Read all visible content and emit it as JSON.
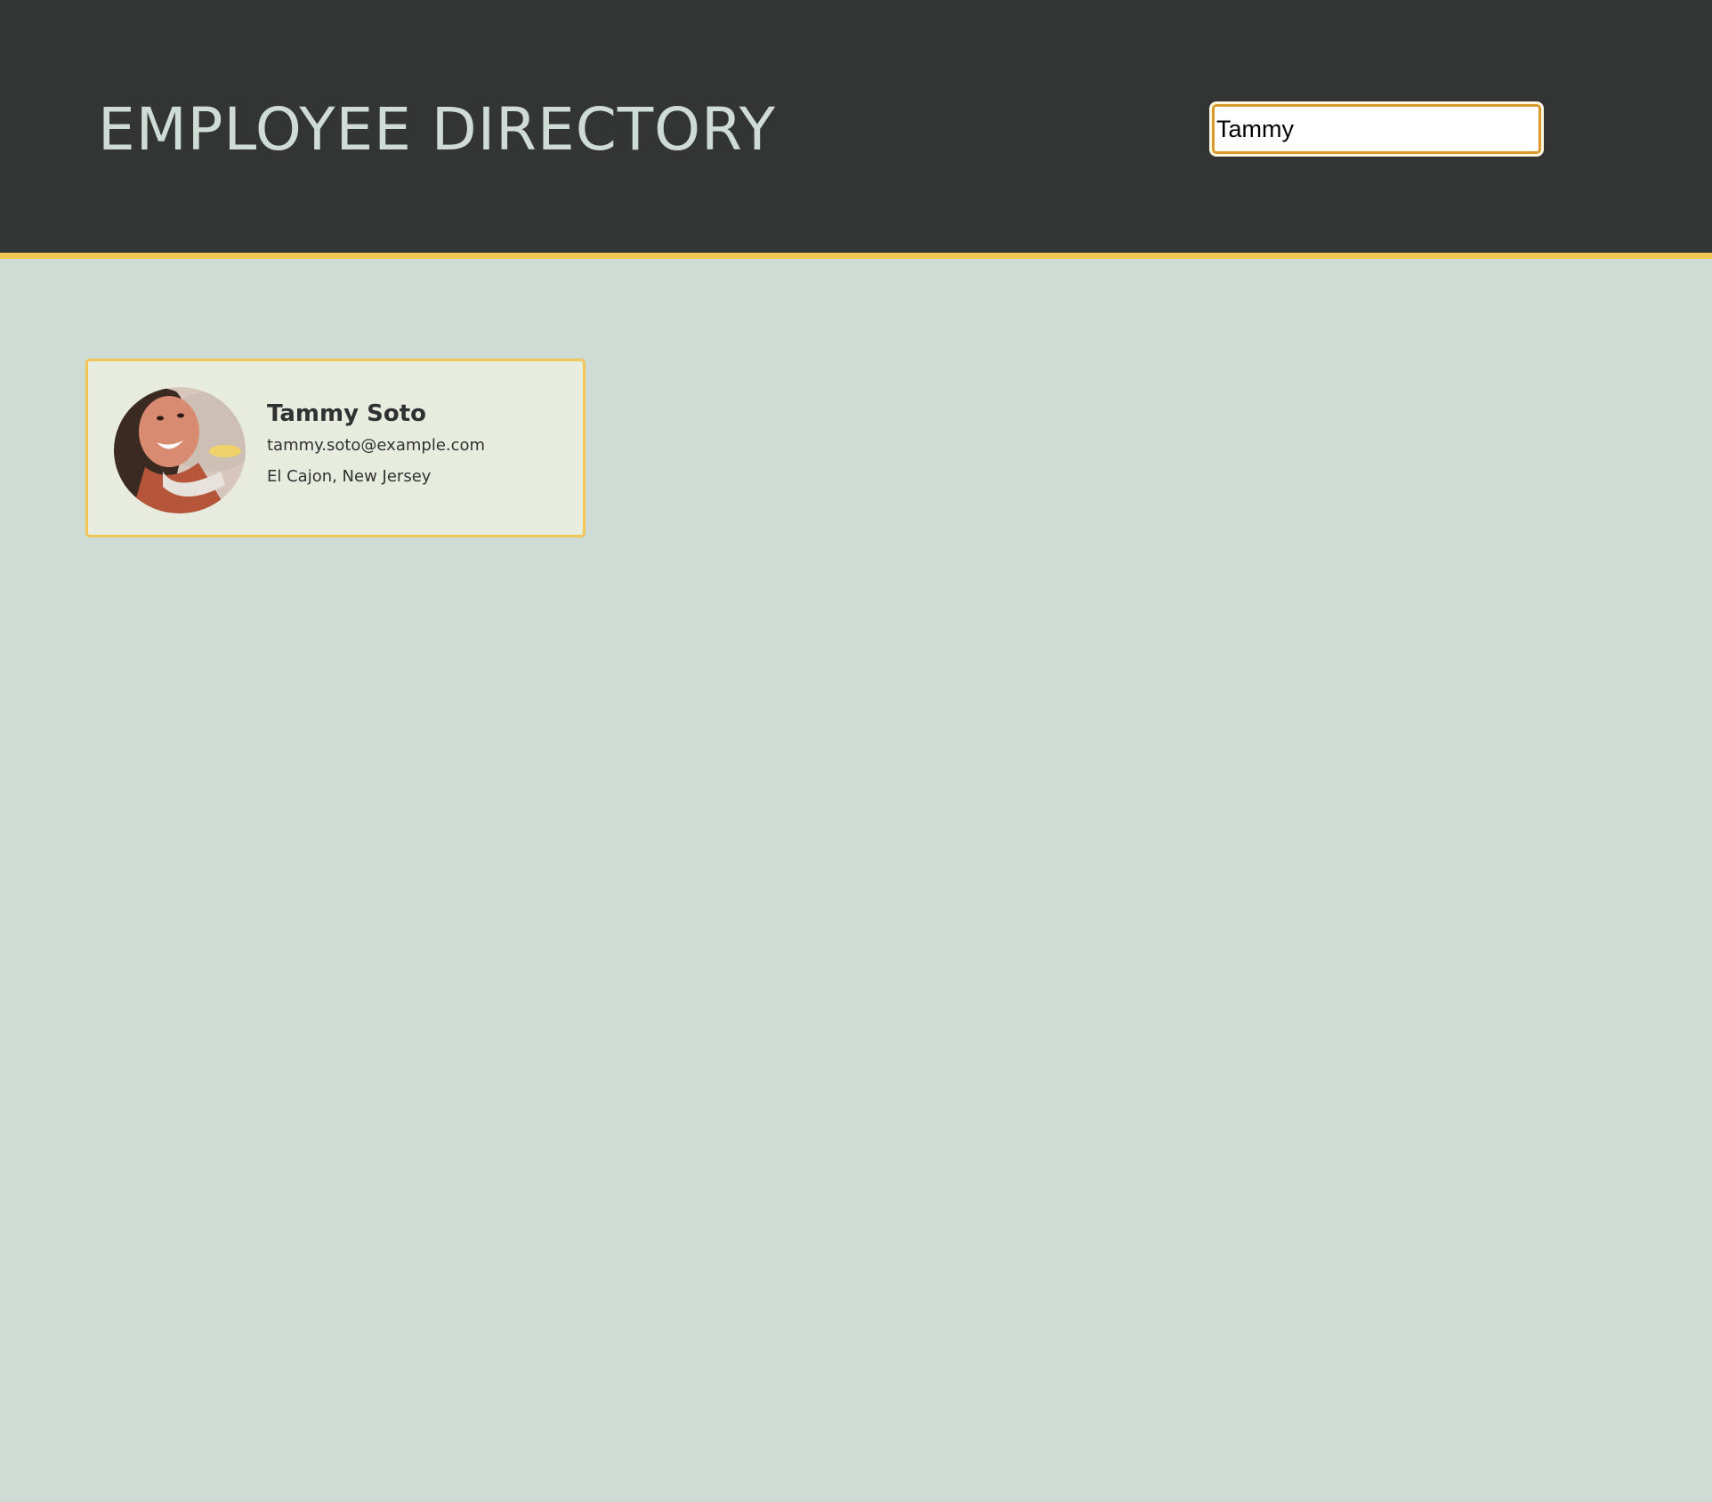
{
  "header": {
    "title": "EMPLOYEE DIRECTORY"
  },
  "search": {
    "value": "Tammy"
  },
  "employees": [
    {
      "name": "Tammy Soto",
      "email": "tammy.soto@example.com",
      "location": "El Cajon, New Jersey",
      "avatar_icon": "avatar-photo"
    }
  ],
  "colors": {
    "header_bg": "#333535",
    "accent": "#f2c654",
    "page_bg": "#cfdcd5",
    "card_bg": "#e8ecdf",
    "search_border": "#d99a2b"
  }
}
